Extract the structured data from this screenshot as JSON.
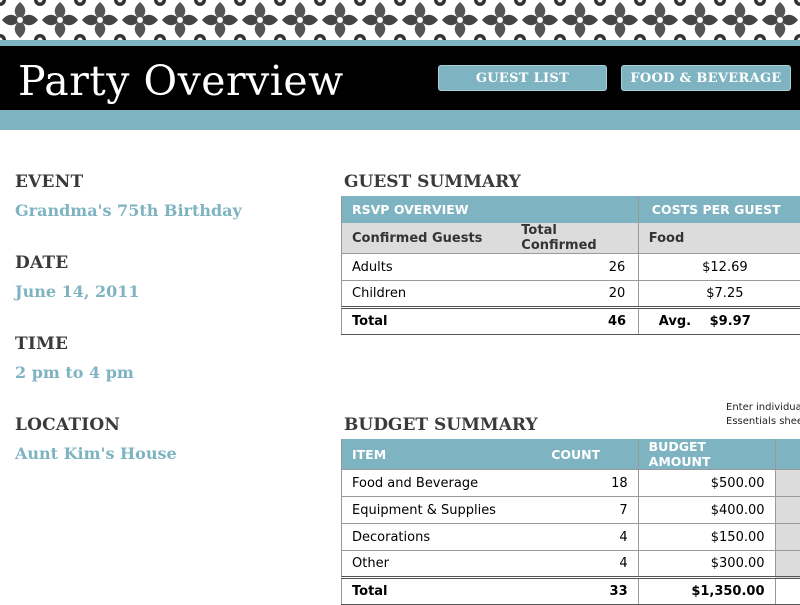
{
  "header": {
    "title": "Party Overview",
    "nav": {
      "guest_list": "GUEST LIST",
      "food_beverage": "FOOD & BEVERAGE"
    }
  },
  "event_info": {
    "event_label": "EVENT",
    "event_value": "Grandma's 75th Birthday",
    "date_label": "DATE",
    "date_value": "June 14, 2011",
    "time_label": "TIME",
    "time_value": "2 pm to 4 pm",
    "location_label": "LOCATION",
    "location_value": "Aunt Kim's House"
  },
  "guest_summary": {
    "title": "GUEST SUMMARY",
    "rsvp_header": "RSVP OVERVIEW",
    "costs_header": "COSTS PER GUEST",
    "col_confirmed": "Confirmed Guests",
    "col_total": "Total Confirmed",
    "col_food": "Food",
    "rows": [
      {
        "label": "Adults",
        "count": "26",
        "food": "$12.69"
      },
      {
        "label": "Children",
        "count": "20",
        "food": "$7.25"
      }
    ],
    "total": {
      "label": "Total",
      "count": "46",
      "avg_label": "Avg.",
      "avg": "$9.97"
    }
  },
  "budget_summary": {
    "title": "BUDGET SUMMARY",
    "note_line1": "Enter individua",
    "note_line2": "Essentials shee",
    "col_item": "ITEM",
    "col_count": "COUNT",
    "col_amount": "BUDGET AMOUNT",
    "rows": [
      {
        "item": "Food and Beverage",
        "count": "18",
        "amount": "$500.00"
      },
      {
        "item": "Equipment & Supplies",
        "count": "7",
        "amount": "$400.00"
      },
      {
        "item": "Decorations",
        "count": "4",
        "amount": "$150.00"
      },
      {
        "item": "Other",
        "count": "4",
        "amount": "$300.00"
      }
    ],
    "total": {
      "label": "Total",
      "count": "33",
      "amount": "$1,350.00"
    }
  },
  "colors": {
    "accent": "#7eb3c2",
    "header_bg": "#000000",
    "label_text": "#3a3a3a"
  }
}
